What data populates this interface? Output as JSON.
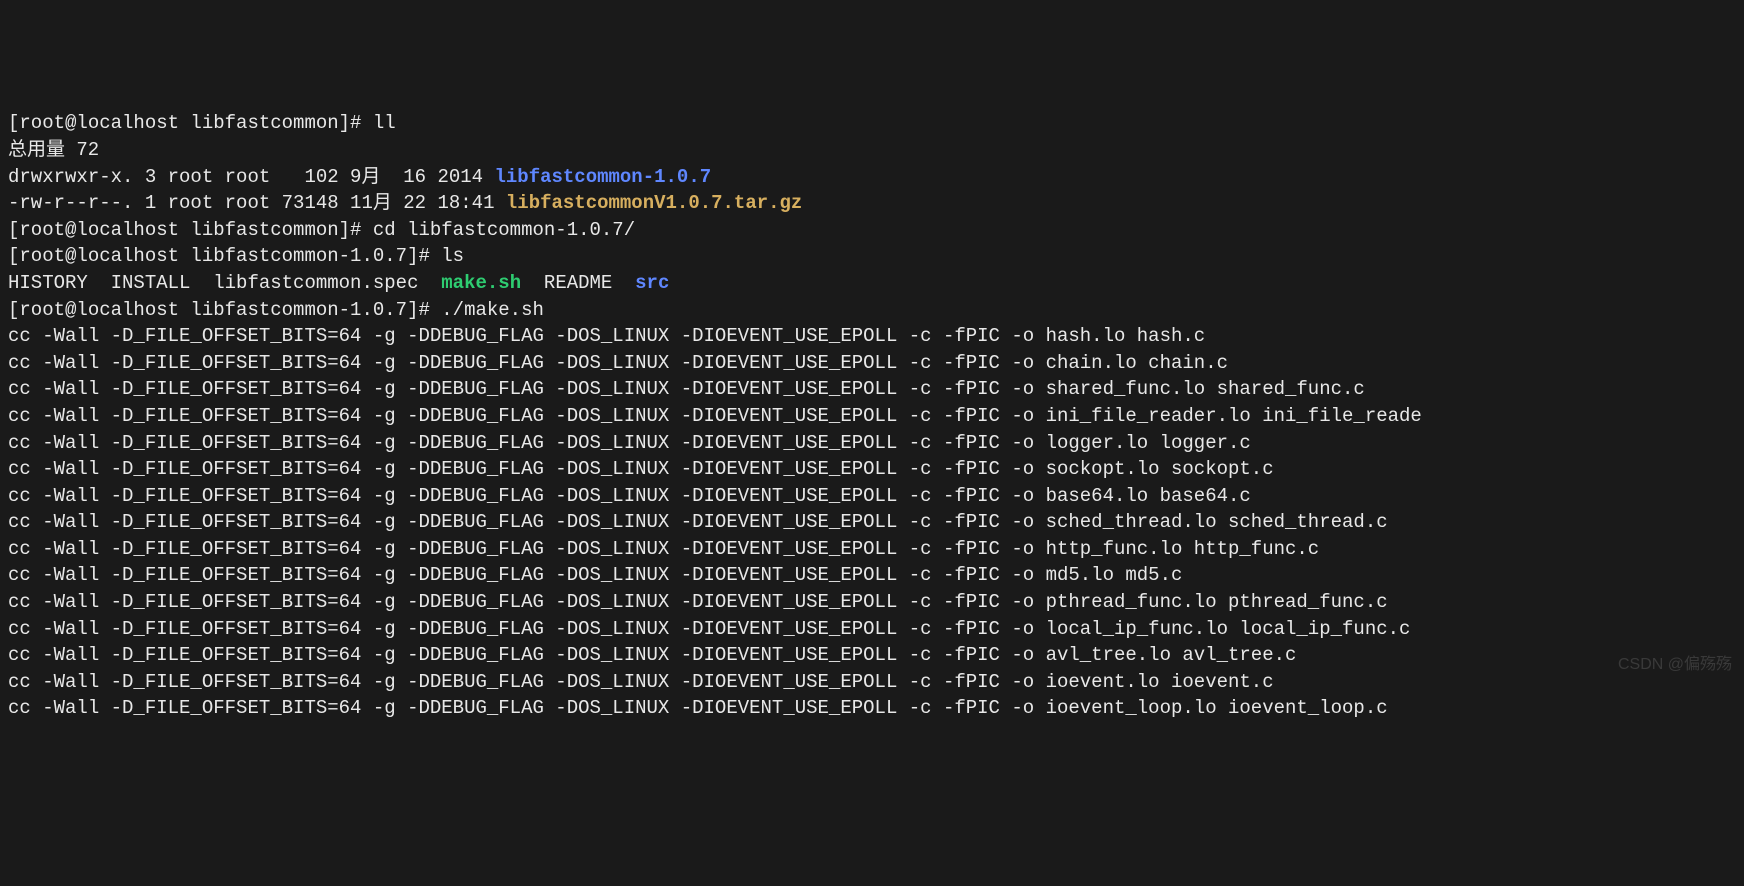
{
  "lines": [
    {
      "segments": [
        {
          "t": "[root@localhost libfastcommon]# ll"
        }
      ]
    },
    {
      "segments": [
        {
          "t": "总用量 72"
        }
      ]
    },
    {
      "segments": [
        {
          "t": "drwxrwxr-x. 3 root root   102 9月  16 2014 "
        },
        {
          "t": "libfastcommon-1.0.7",
          "cls": "dir"
        }
      ]
    },
    {
      "segments": [
        {
          "t": "-rw-r--r--. 1 root root 73148 11月 22 18:41 "
        },
        {
          "t": "libfastcommonV1.0.7.tar.gz",
          "cls": "tar"
        }
      ]
    },
    {
      "segments": [
        {
          "t": "[root@localhost libfastcommon]# cd libfastcommon-1.0.7/"
        }
      ]
    },
    {
      "segments": [
        {
          "t": "[root@localhost libfastcommon-1.0.7]# ls"
        }
      ]
    },
    {
      "segments": [
        {
          "t": "HISTORY  INSTALL  libfastcommon.spec  "
        },
        {
          "t": "make.sh",
          "cls": "exec"
        },
        {
          "t": "  README  "
        },
        {
          "t": "src",
          "cls": "dir"
        }
      ]
    },
    {
      "segments": [
        {
          "t": "[root@localhost libfastcommon-1.0.7]# ./make.sh"
        }
      ]
    },
    {
      "segments": [
        {
          "t": "cc -Wall -D_FILE_OFFSET_BITS=64 -g -DDEBUG_FLAG -DOS_LINUX -DIOEVENT_USE_EPOLL -c -fPIC -o hash.lo hash.c"
        }
      ]
    },
    {
      "segments": [
        {
          "t": "cc -Wall -D_FILE_OFFSET_BITS=64 -g -DDEBUG_FLAG -DOS_LINUX -DIOEVENT_USE_EPOLL -c -fPIC -o chain.lo chain.c"
        }
      ]
    },
    {
      "segments": [
        {
          "t": "cc -Wall -D_FILE_OFFSET_BITS=64 -g -DDEBUG_FLAG -DOS_LINUX -DIOEVENT_USE_EPOLL -c -fPIC -o shared_func.lo shared_func.c"
        }
      ]
    },
    {
      "segments": [
        {
          "t": "cc -Wall -D_FILE_OFFSET_BITS=64 -g -DDEBUG_FLAG -DOS_LINUX -DIOEVENT_USE_EPOLL -c -fPIC -o ini_file_reader.lo ini_file_reade"
        }
      ]
    },
    {
      "segments": [
        {
          "t": "cc -Wall -D_FILE_OFFSET_BITS=64 -g -DDEBUG_FLAG -DOS_LINUX -DIOEVENT_USE_EPOLL -c -fPIC -o logger.lo logger.c"
        }
      ]
    },
    {
      "segments": [
        {
          "t": "cc -Wall -D_FILE_OFFSET_BITS=64 -g -DDEBUG_FLAG -DOS_LINUX -DIOEVENT_USE_EPOLL -c -fPIC -o sockopt.lo sockopt.c"
        }
      ]
    },
    {
      "segments": [
        {
          "t": "cc -Wall -D_FILE_OFFSET_BITS=64 -g -DDEBUG_FLAG -DOS_LINUX -DIOEVENT_USE_EPOLL -c -fPIC -o base64.lo base64.c"
        }
      ]
    },
    {
      "segments": [
        {
          "t": "cc -Wall -D_FILE_OFFSET_BITS=64 -g -DDEBUG_FLAG -DOS_LINUX -DIOEVENT_USE_EPOLL -c -fPIC -o sched_thread.lo sched_thread.c"
        }
      ]
    },
    {
      "segments": [
        {
          "t": "cc -Wall -D_FILE_OFFSET_BITS=64 -g -DDEBUG_FLAG -DOS_LINUX -DIOEVENT_USE_EPOLL -c -fPIC -o http_func.lo http_func.c"
        }
      ]
    },
    {
      "segments": [
        {
          "t": "cc -Wall -D_FILE_OFFSET_BITS=64 -g -DDEBUG_FLAG -DOS_LINUX -DIOEVENT_USE_EPOLL -c -fPIC -o md5.lo md5.c"
        }
      ]
    },
    {
      "segments": [
        {
          "t": "cc -Wall -D_FILE_OFFSET_BITS=64 -g -DDEBUG_FLAG -DOS_LINUX -DIOEVENT_USE_EPOLL -c -fPIC -o pthread_func.lo pthread_func.c"
        }
      ]
    },
    {
      "segments": [
        {
          "t": "cc -Wall -D_FILE_OFFSET_BITS=64 -g -DDEBUG_FLAG -DOS_LINUX -DIOEVENT_USE_EPOLL -c -fPIC -o local_ip_func.lo local_ip_func.c"
        }
      ]
    },
    {
      "segments": [
        {
          "t": "cc -Wall -D_FILE_OFFSET_BITS=64 -g -DDEBUG_FLAG -DOS_LINUX -DIOEVENT_USE_EPOLL -c -fPIC -o avl_tree.lo avl_tree.c"
        }
      ]
    },
    {
      "segments": [
        {
          "t": "cc -Wall -D_FILE_OFFSET_BITS=64 -g -DDEBUG_FLAG -DOS_LINUX -DIOEVENT_USE_EPOLL -c -fPIC -o ioevent.lo ioevent.c"
        }
      ]
    },
    {
      "segments": [
        {
          "t": "cc -Wall -D_FILE_OFFSET_BITS=64 -g -DDEBUG_FLAG -DOS_LINUX -DIOEVENT_USE_EPOLL -c -fPIC -o ioevent_loop.lo ioevent_loop.c"
        }
      ]
    }
  ],
  "watermark": "CSDN @偏殇殇"
}
